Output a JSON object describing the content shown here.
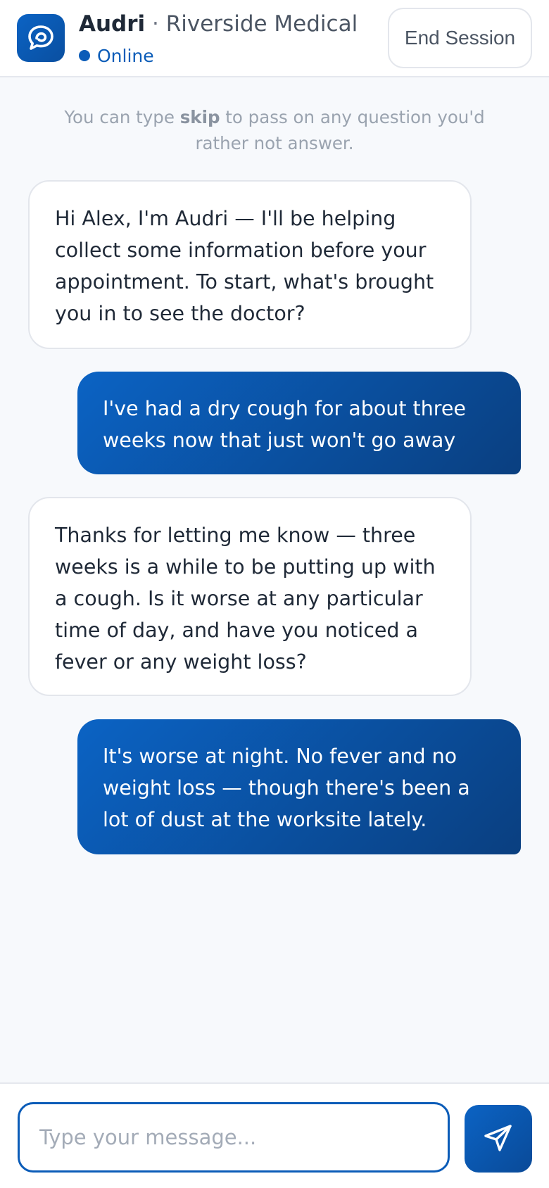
{
  "header": {
    "assistant_name": "Audri",
    "separator": " · ",
    "clinic_name": "Riverside Medical",
    "status": "Online",
    "end_session_label": "End Session"
  },
  "hint": {
    "before": "You can type ",
    "keyword": "skip",
    "after": " to pass on any question you'd rather not answer."
  },
  "messages": [
    {
      "role": "bot",
      "text": "Hi Alex, I'm Audri — I'll be helping collect some information before your appointment. To start, what's brought you in to see the doctor?"
    },
    {
      "role": "user",
      "text": "I've had a dry cough for about three weeks now that just won't go away"
    },
    {
      "role": "bot",
      "text": "Thanks for letting me know — three weeks is a while to be putting up with a cough. Is it worse at any particular time of day, and have you noticed a fever or any weight loss?"
    },
    {
      "role": "user",
      "text": "It's worse at night. No fever and no weight loss — though there's been a lot of dust at the worksite lately."
    }
  ],
  "composer": {
    "placeholder": "Type your message...",
    "value": ""
  },
  "icons": {
    "logo": "chat-bubble-icon",
    "send": "paper-plane-icon"
  },
  "colors": {
    "accent": "#0b5cb8",
    "user_bubble_start": "#0b63c4",
    "user_bubble_end": "#0a3f80",
    "background": "#f7f9fc"
  }
}
